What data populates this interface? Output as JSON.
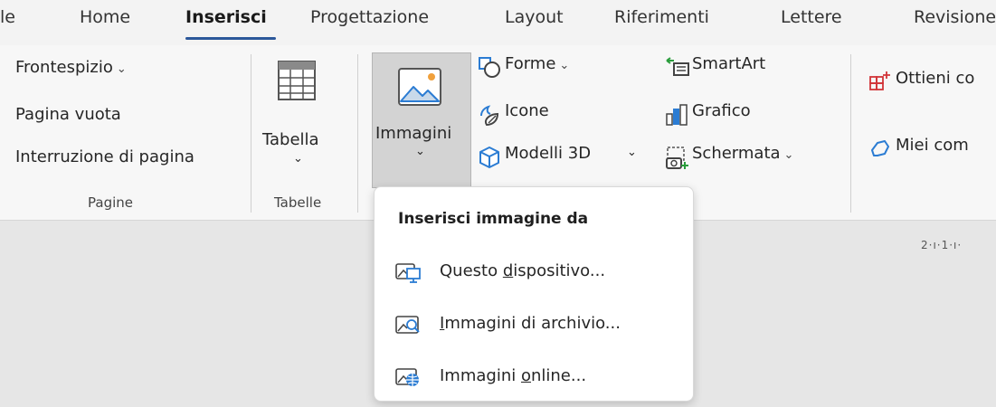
{
  "tabs": [
    {
      "label": "le"
    },
    {
      "label": "Home"
    },
    {
      "label": "Inserisci",
      "active": true
    },
    {
      "label": "Progettazione"
    },
    {
      "label": "Layout"
    },
    {
      "label": "Riferimenti"
    },
    {
      "label": "Lettere"
    },
    {
      "label": "Revisione"
    }
  ],
  "ribbon": {
    "pagine": {
      "items": [
        "Frontespizio",
        "Pagina vuota",
        "Interruzione di pagina"
      ],
      "group_label": "Pagine"
    },
    "tabelle": {
      "button_label": "Tabella",
      "group_label": "Tabelle"
    },
    "illustrazioni": {
      "immagini_label": "Immagini",
      "forme_label": "Forme",
      "icone_label": "Icone",
      "modelli3d_label": "Modelli 3D",
      "smartart_label": "SmartArt",
      "grafico_label": "Grafico",
      "schermata_label": "Schermata"
    },
    "componenti": {
      "ottieni_label": "Ottieni co",
      "miei_label": "Miei com"
    }
  },
  "ruler": {
    "text": "2·ı·1·ı·"
  },
  "dropdown": {
    "title": "Inserisci immagine da",
    "items": [
      {
        "pre": "Questo ",
        "u": "d",
        "post": "ispositivo...",
        "icon": "device-image-icon"
      },
      {
        "pre": "",
        "u": "I",
        "post": "mmagini di archivio...",
        "icon": "stock-image-icon"
      },
      {
        "pre": "Immagini ",
        "u": "o",
        "post": "nline...",
        "icon": "online-image-icon"
      }
    ]
  },
  "colors": {
    "accent": "#2b579a",
    "ribbon_bg": "#f7f7f7",
    "doc_bg": "#e6e6e6"
  }
}
